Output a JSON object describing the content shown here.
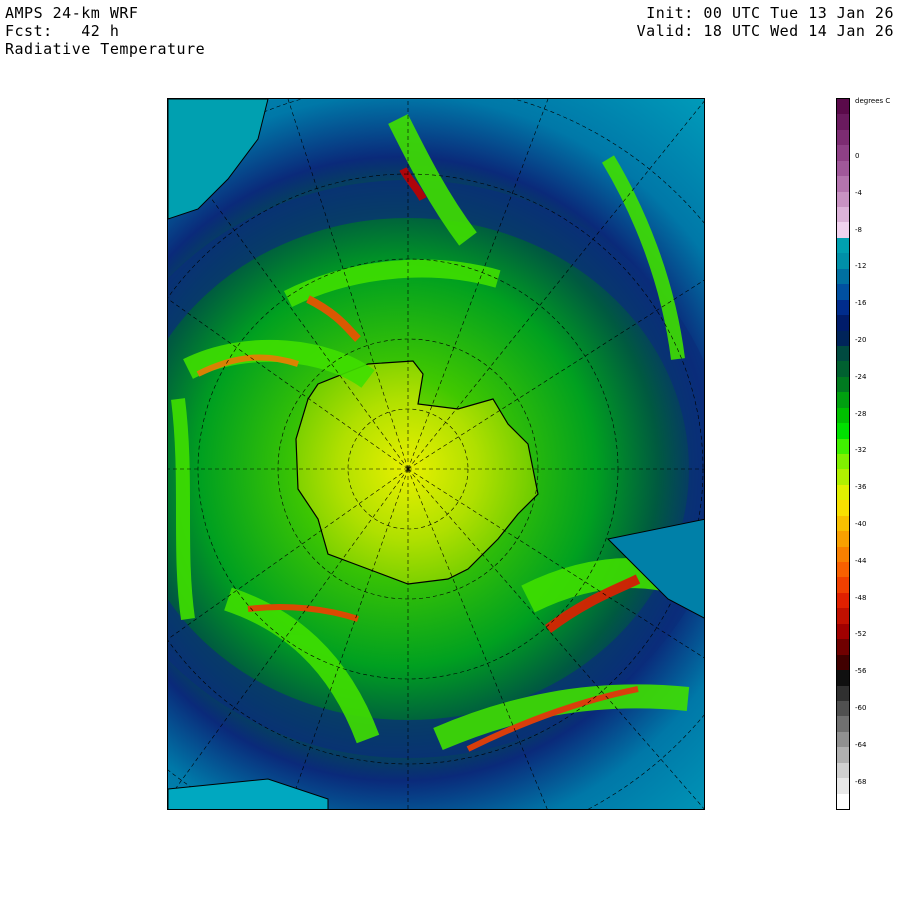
{
  "header": {
    "model": "AMPS 24-km WRF",
    "forecast": "Fcst:   42 h",
    "field": "Radiative Temperature",
    "init": "Init: 00 UTC Tue 13 Jan 26",
    "valid": "Valid: 18 UTC Wed 14 Jan 26"
  },
  "colorbar": {
    "units": "degrees C",
    "labels": [
      "0",
      "-4",
      "-8",
      "-12",
      "-16",
      "-20",
      "-24",
      "-28",
      "-32",
      "-36",
      "-40",
      "-44",
      "-48",
      "-52",
      "-56",
      "-60",
      "-64",
      "-68"
    ],
    "colors": [
      "#5a0a4a",
      "#6a1a5e",
      "#7c2c72",
      "#8e4086",
      "#a0589a",
      "#b474ae",
      "#c892c2",
      "#dcb2d8",
      "#f0d2ee",
      "#00a0b0",
      "#0090a8",
      "#0070a0",
      "#0050a0",
      "#002c8c",
      "#001c6a",
      "#00245a",
      "#004a40",
      "#006030",
      "#007a20",
      "#00a010",
      "#00c000",
      "#00e000",
      "#40f000",
      "#80f000",
      "#b0f000",
      "#e0f000",
      "#f8e000",
      "#f8c000",
      "#f8a000",
      "#f88000",
      "#f86000",
      "#f04000",
      "#e02000",
      "#c01000",
      "#a00000",
      "#700000",
      "#400000",
      "#101010",
      "#303030",
      "#505050",
      "#707070",
      "#909090",
      "#b0b0b0",
      "#d0d0d0",
      "#e8e8e8",
      "#ffffff"
    ]
  }
}
